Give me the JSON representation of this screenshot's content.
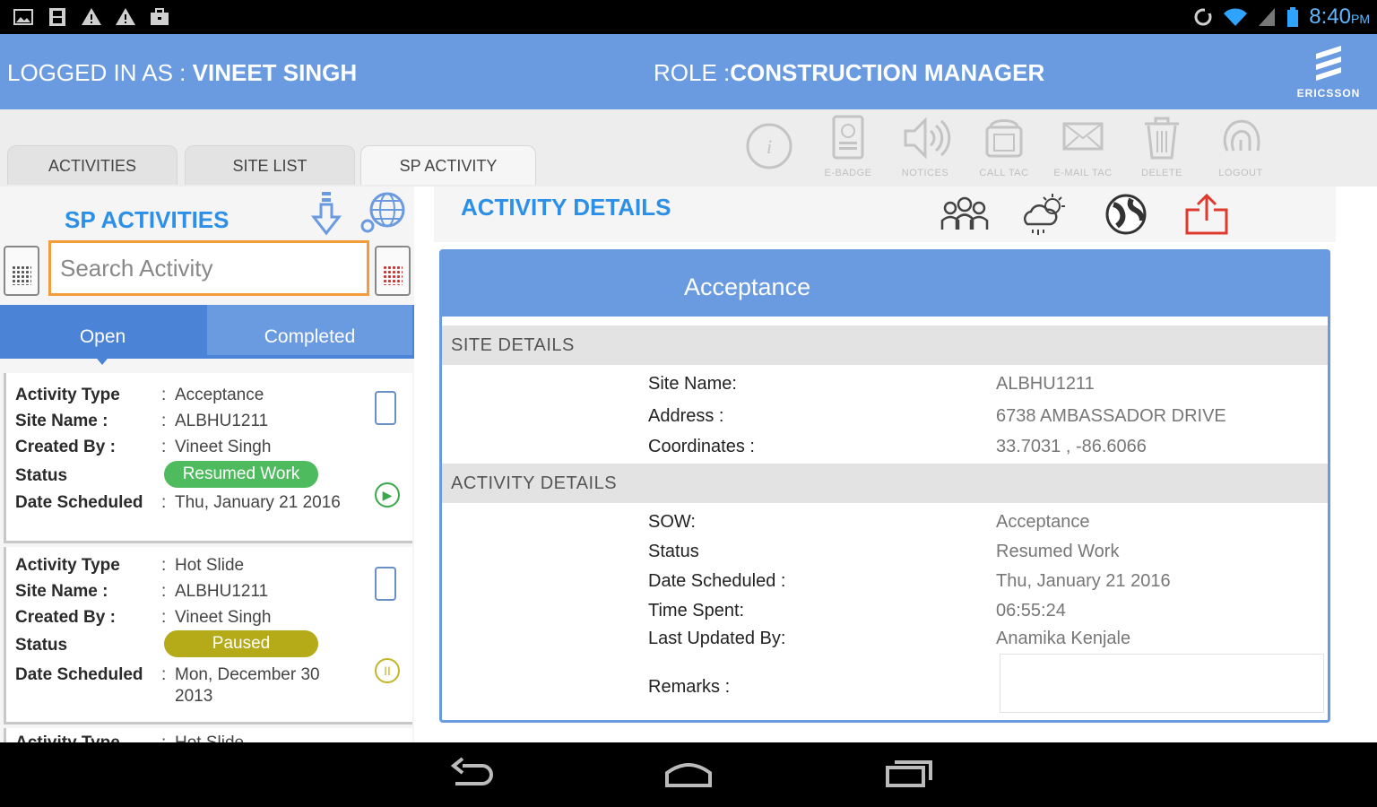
{
  "status_bar": {
    "time": "8:40",
    "ampm": "PM",
    "left_icons": [
      "gallery-icon",
      "film-icon",
      "warning-icon",
      "warning-icon",
      "briefcase-icon"
    ],
    "right_icons": [
      "sync-icon",
      "wifi-icon",
      "signal-icon",
      "battery-icon"
    ]
  },
  "header": {
    "login_prefix": "LOGGED IN AS : ",
    "login_user": "VINEET SINGH",
    "role_prefix": "ROLE :",
    "role_name": "CONSTRUCTION MANAGER",
    "logo_text": "ERICSSON"
  },
  "tabs": [
    {
      "label": "ACTIVITIES",
      "active": false
    },
    {
      "label": "SITE LIST",
      "active": false
    },
    {
      "label": "SP ACTIVITY",
      "active": true
    }
  ],
  "toolbar": [
    {
      "icon": "info-icon",
      "label": ""
    },
    {
      "icon": "badge-icon",
      "label": "E-BADGE"
    },
    {
      "icon": "speaker-icon",
      "label": "NOTICES"
    },
    {
      "icon": "phone-icon",
      "label": "CALL TAC"
    },
    {
      "icon": "mail-icon",
      "label": "E-MAIL TAC"
    },
    {
      "icon": "trash-icon",
      "label": "DELETE"
    },
    {
      "icon": "fingerprint-icon",
      "label": "LOGOUT"
    }
  ],
  "sp_activities": {
    "title": "SP ACTIVITIES",
    "search_placeholder": "Search Activity",
    "segments": {
      "open": "Open",
      "completed": "Completed"
    },
    "labels": {
      "activity_type": "Activity Type",
      "site_name": "Site Name :",
      "created_by": "Created By :",
      "status": "Status",
      "date_scheduled": "Date Scheduled",
      "colon": ":"
    },
    "items": [
      {
        "activity_type": "Acceptance",
        "site_name": "ALBHU1211",
        "created_by": "Vineet Singh",
        "status": "Resumed Work",
        "date_line1": "Thu, January 21 2016",
        "date_line2": ""
      },
      {
        "activity_type": "Hot Slide",
        "site_name": "ALBHU1211",
        "created_by": "Vineet Singh",
        "status": "Paused",
        "date_line1": "Mon, December 30",
        "date_line2": "2013"
      },
      {
        "activity_type": "Hot Slide"
      }
    ]
  },
  "activity_details": {
    "title": "ACTIVITY DETAILS",
    "panel_title": "Acceptance",
    "site_section": "SITE DETAILS",
    "site": [
      {
        "k": "Site Name:",
        "v": "ALBHU1211"
      },
      {
        "k": "Address :",
        "v": "6738 AMBASSADOR DRIVE"
      },
      {
        "k": "Coordinates :",
        "v": "33.7031 , -86.6066"
      }
    ],
    "activity_section": "ACTIVITY DETAILS",
    "activity": [
      {
        "k": "SOW:",
        "v": "Acceptance"
      },
      {
        "k": "Status",
        "v": "Resumed Work"
      },
      {
        "k": "Date Scheduled :",
        "v": "Thu, January 21 2016"
      },
      {
        "k": "Time Spent:",
        "v": "06:55:24"
      },
      {
        "k": "Last Updated By:",
        "v": "Anamika Kenjale"
      }
    ],
    "remarks_label": "Remarks :",
    "remarks_value": ""
  },
  "colors": {
    "header_bg": "#6a9be0",
    "accent_blue": "#2c8fe8",
    "search_border": "#f39c3b",
    "status_green": "#4dbb5e",
    "status_olive": "#b5aa17",
    "export_red": "#e03a2f"
  }
}
